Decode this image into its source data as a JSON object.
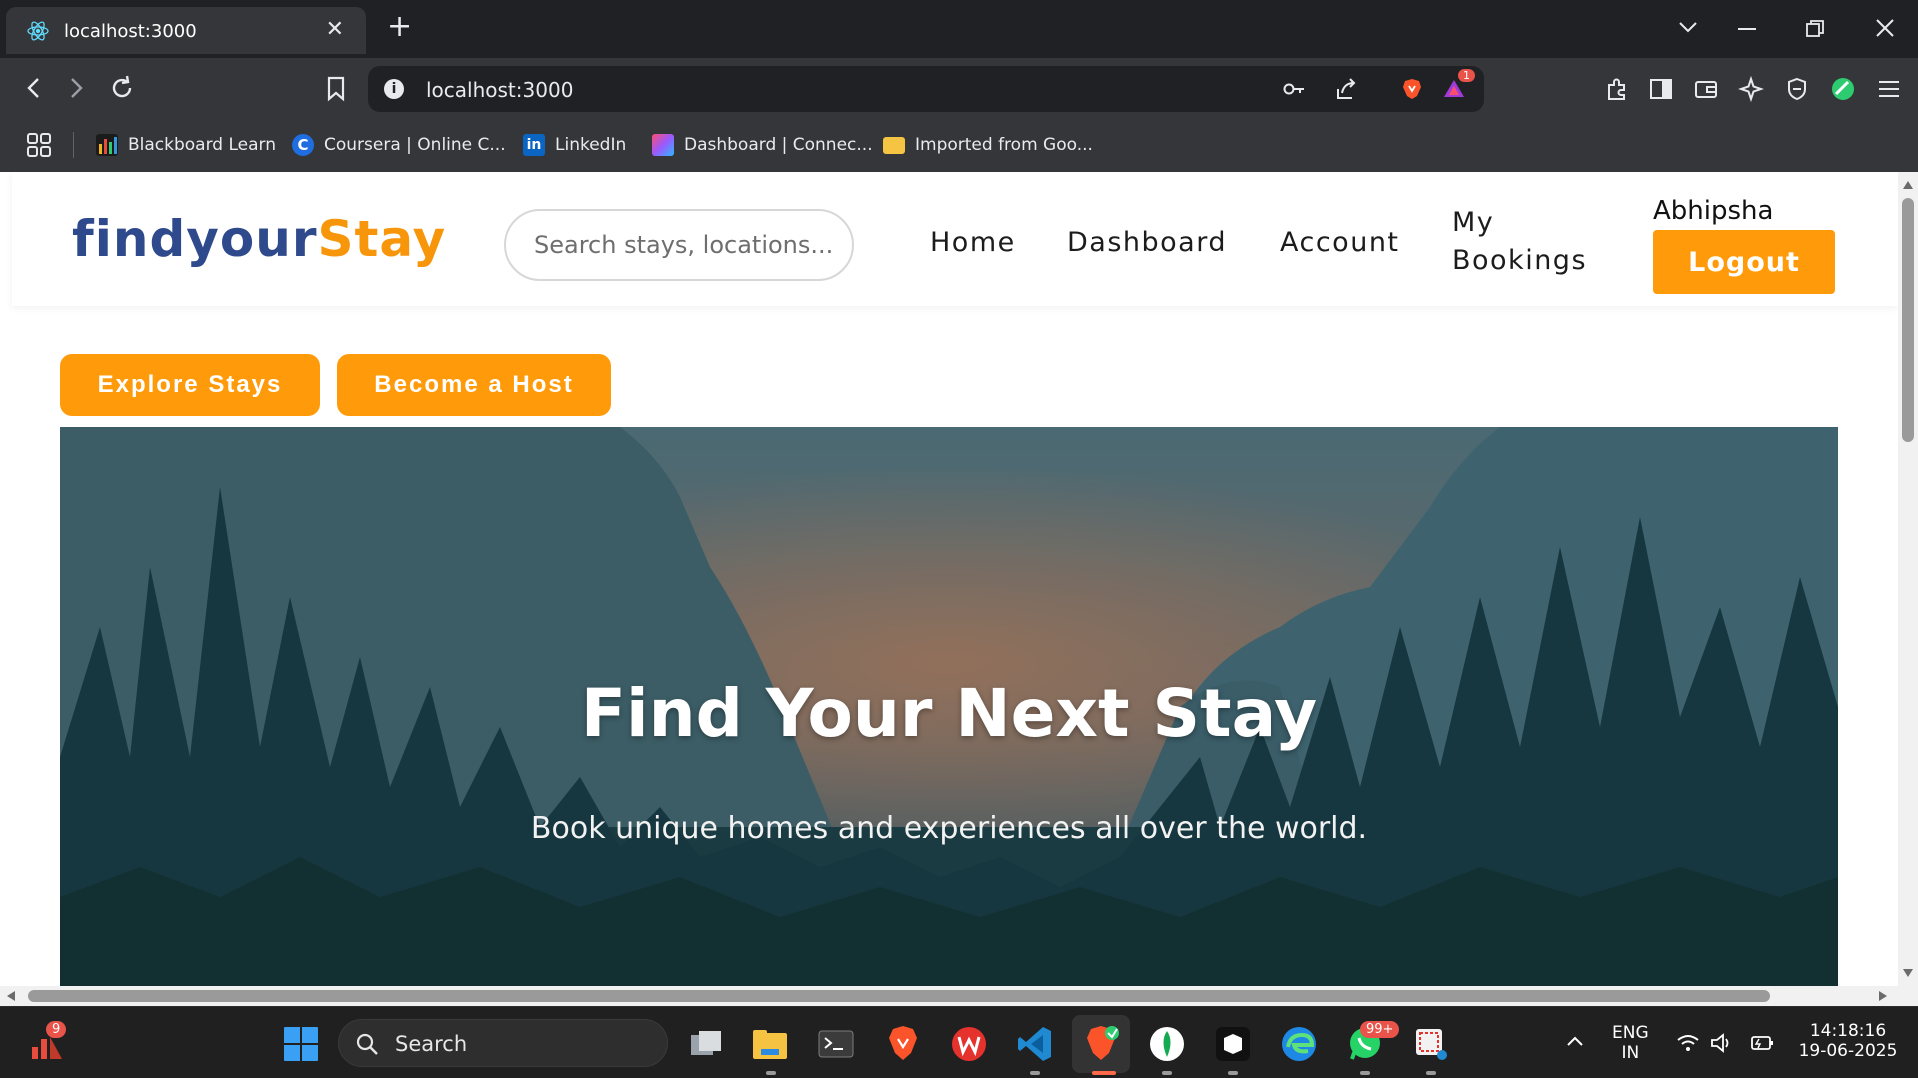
{
  "browser": {
    "tab_title": "localhost:3000",
    "close_glyph": "✕",
    "new_tab_glyph": "+",
    "url": "localhost:3000",
    "notification_count": "1",
    "bookmarks": [
      {
        "label": "Blackboard Learn",
        "color": "#f1b61f"
      },
      {
        "label": "Coursera | Online C...",
        "color": "#1f6de0"
      },
      {
        "label": "LinkedIn",
        "color": "#0a66c2"
      },
      {
        "label": "Dashboard | Connec...",
        "color": "#9b59ff"
      },
      {
        "label": "Imported from Goo...",
        "color": "#f6c443"
      }
    ]
  },
  "site": {
    "brand_part1": "findyour",
    "brand_part2": "Stay",
    "search_placeholder": "Search stays, locations...",
    "nav": {
      "home": "Home",
      "dashboard": "Dashboard",
      "account": "Account",
      "my_bookings_line1": "My",
      "my_bookings_line2": "Bookings"
    },
    "username": "Abhipsha",
    "logout_label": "Logout",
    "explore_label": "Explore Stays",
    "host_label": "Become a Host",
    "hero_title": "Find Your Next Stay",
    "hero_subtitle": "Book unique homes and experiences all over the world."
  },
  "colors": {
    "brand_blue": "#2f4a8c",
    "accent_orange": "#ff9b0a"
  },
  "taskbar": {
    "search_label": "Search",
    "widgets_badge": "9",
    "whatsapp_badge": "99+",
    "lang_line1": "ENG",
    "lang_line2": "IN",
    "time": "14:18:16",
    "date": "19-06-2025"
  }
}
